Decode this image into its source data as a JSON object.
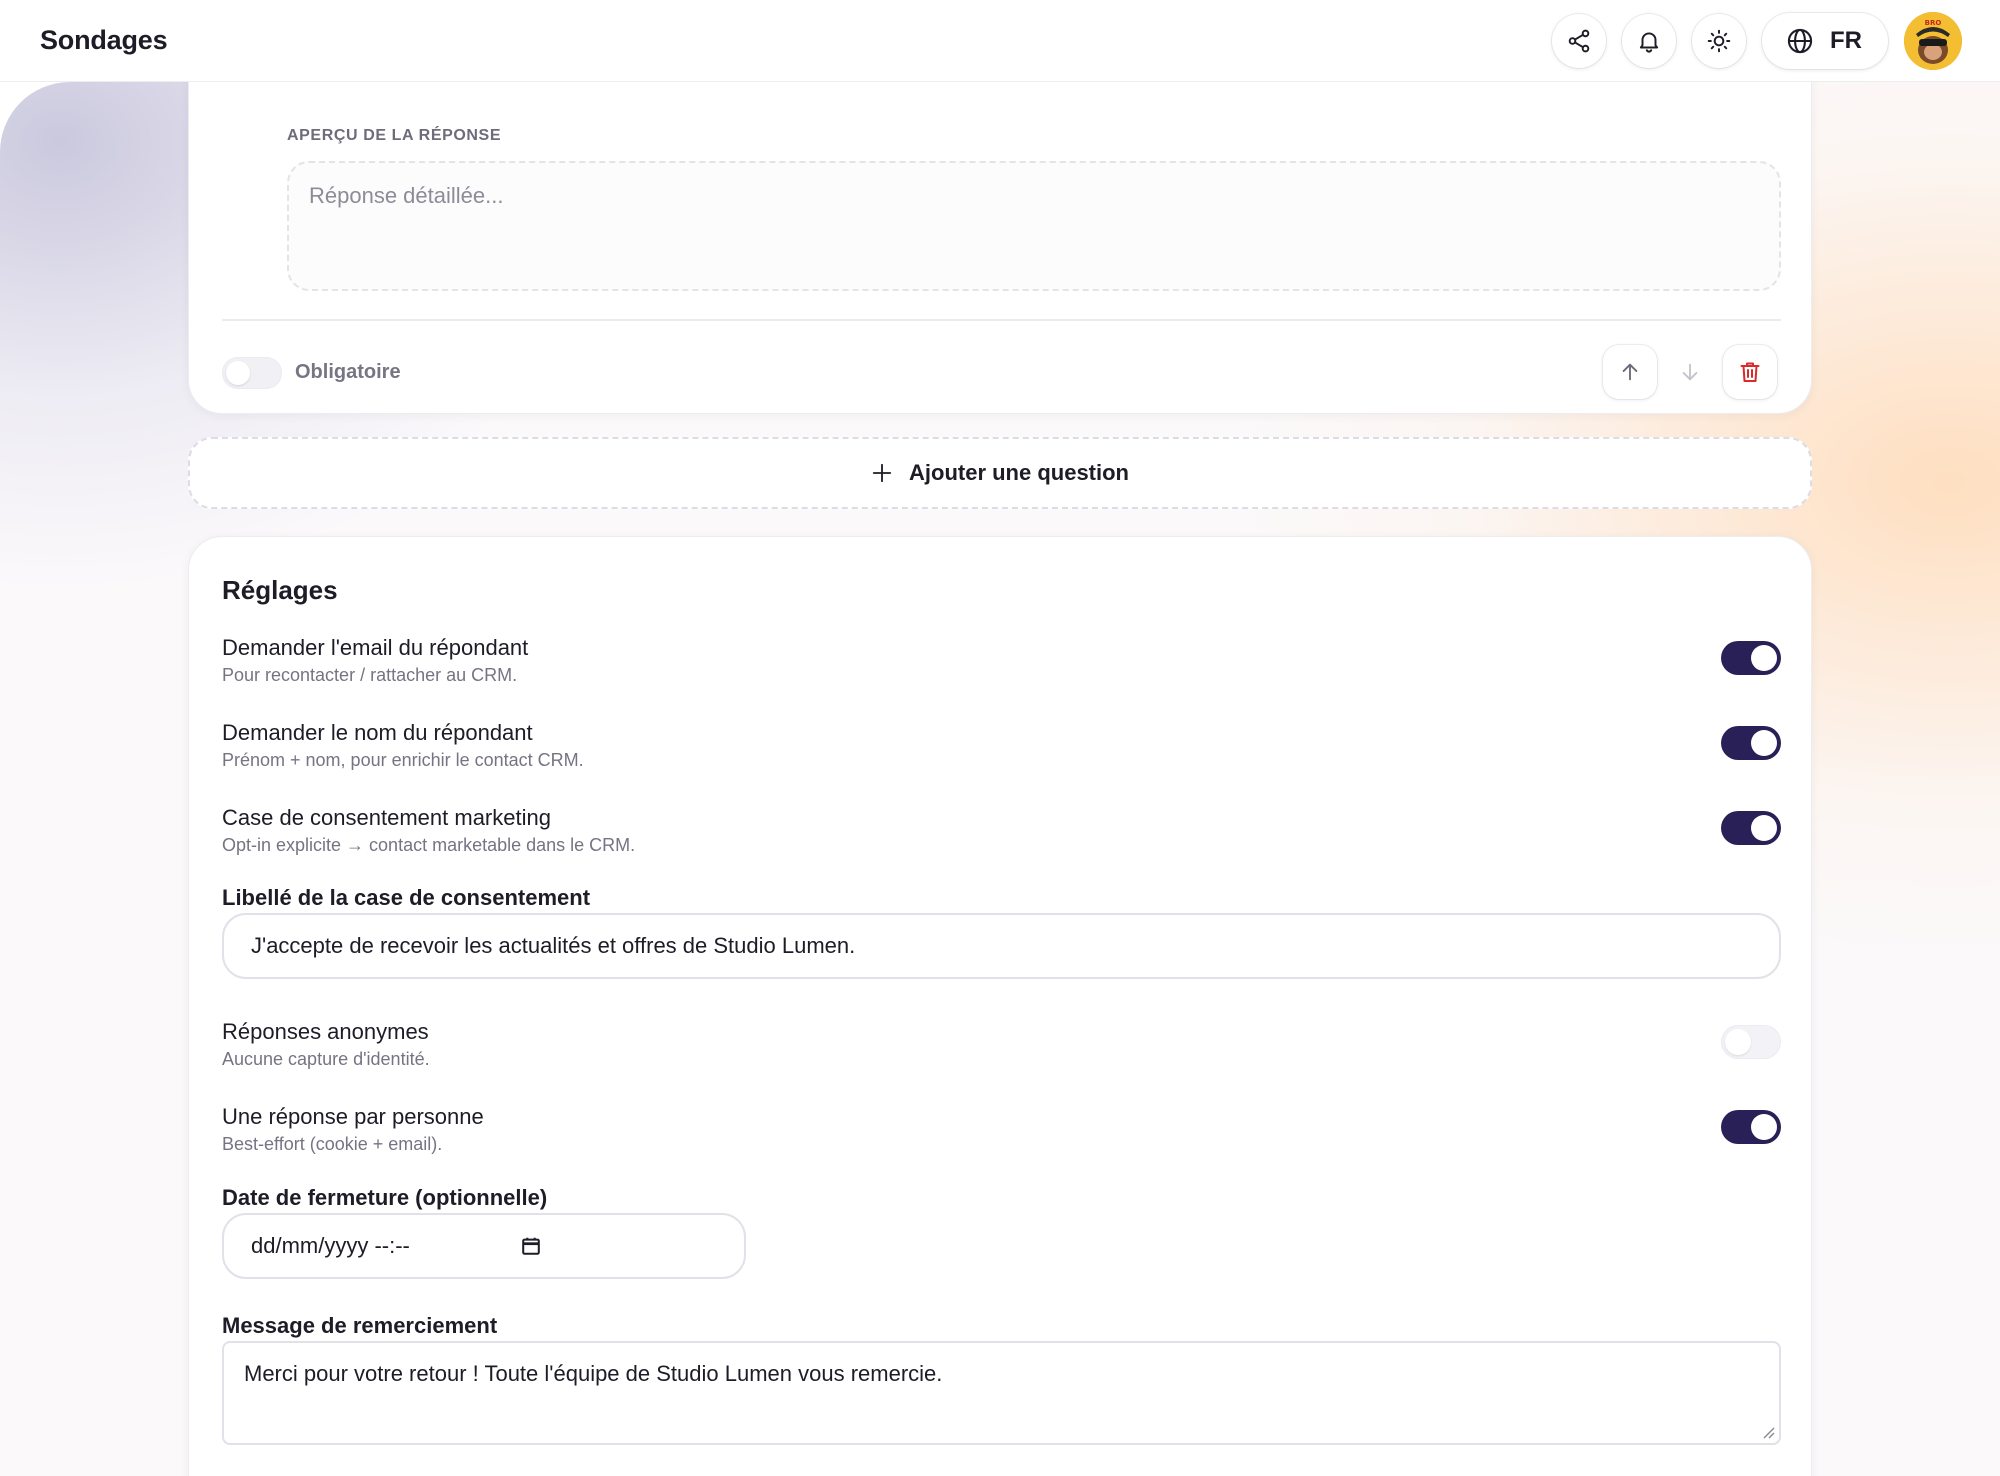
{
  "header": {
    "title": "Sondages",
    "share_icon": "share-icon",
    "bell_icon": "bell-icon",
    "theme_icon": "sun-icon",
    "language": "FR",
    "avatar_badge": "BRO"
  },
  "question_card": {
    "preview_label": "APERÇU DE LA RÉPONSE",
    "preview_placeholder": "Réponse détaillée...",
    "required_label": "Obligatoire",
    "required": false
  },
  "add_question": {
    "label": "Ajouter une question"
  },
  "settings": {
    "title": "Réglages",
    "toggles": [
      {
        "title": "Demander l'email du répondant",
        "subtitle": "Pour recontacter / rattacher au CRM.",
        "on": true
      },
      {
        "title": "Demander le nom du répondant",
        "subtitle": "Prénom + nom, pour enrichir le contact CRM.",
        "on": true
      },
      {
        "title": "Case de consentement marketing",
        "subtitle": "Opt-in explicite → contact marketable dans le CRM.",
        "on": true
      }
    ],
    "consent_label_title": "Libellé de la case de consentement",
    "consent_label_value": "J'accepte de recevoir les actualités et offres de Studio Lumen.",
    "toggles2": [
      {
        "title": "Réponses anonymes",
        "subtitle": "Aucune capture d'identité.",
        "on": false
      },
      {
        "title": "Une réponse par personne",
        "subtitle": "Best-effort (cookie + email).",
        "on": true
      }
    ],
    "close_date_title": "Date de fermeture (optionnelle)",
    "close_date_placeholder": "dd/mm/yyyy --:--",
    "thanks_title": "Message de remerciement",
    "thanks_value": "Merci pour votre retour ! Toute l'équipe de Studio Lumen vous remercie."
  },
  "colors": {
    "accent": "#2a2058",
    "danger": "#d92b2b"
  }
}
